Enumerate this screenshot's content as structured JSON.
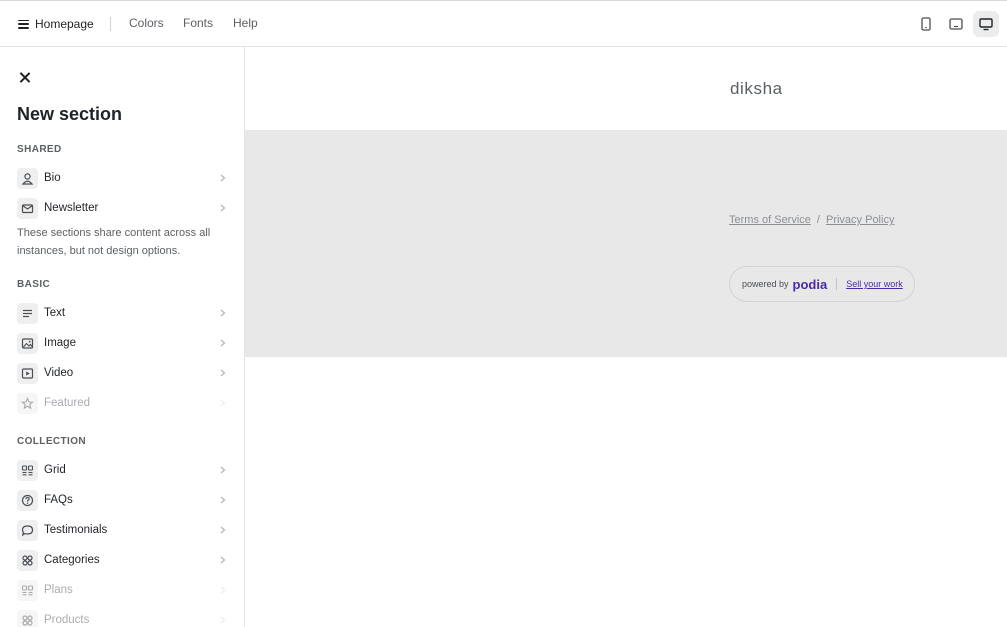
{
  "topbar": {
    "homepage_label": "Homepage",
    "links": [
      "Colors",
      "Fonts",
      "Help"
    ],
    "devices": [
      {
        "icon": "phone-icon"
      },
      {
        "icon": "tablet-icon"
      },
      {
        "icon": "desktop-icon",
        "active": true
      }
    ]
  },
  "sidebar": {
    "title": "New section",
    "shared": {
      "label": "SHARED",
      "items": [
        {
          "label": "Bio",
          "icon": "person-icon"
        },
        {
          "label": "Newsletter",
          "icon": "envelope-icon"
        }
      ],
      "note": "These sections share content across all instances, but not design options."
    },
    "basic": {
      "label": "BASIC",
      "items": [
        {
          "label": "Text",
          "icon": "text-lines-icon"
        },
        {
          "label": "Image",
          "icon": "image-icon"
        },
        {
          "label": "Video",
          "icon": "play-icon"
        },
        {
          "label": "Featured",
          "icon": "star-icon",
          "disabled": true
        }
      ]
    },
    "collection": {
      "label": "COLLECTION",
      "items": [
        {
          "label": "Grid",
          "icon": "grid-list-icon"
        },
        {
          "label": "FAQs",
          "icon": "question-icon"
        },
        {
          "label": "Testimonials",
          "icon": "chat-bubble-icon"
        },
        {
          "label": "Categories",
          "icon": "four-circles-icon"
        },
        {
          "label": "Plans",
          "icon": "grid-list-icon",
          "disabled": true
        },
        {
          "label": "Products",
          "icon": "four-circles-icon",
          "disabled": true
        }
      ]
    }
  },
  "preview": {
    "brand": "diksha",
    "terms": "Terms of Service",
    "divider": "/",
    "privacy": "Privacy Policy",
    "powered_by": "powered by",
    "podia": "podia",
    "sell": "Sell your work",
    "colors": {
      "footer_bg": "#e8e8e8",
      "podia_purple": "#4b2aa8"
    }
  }
}
